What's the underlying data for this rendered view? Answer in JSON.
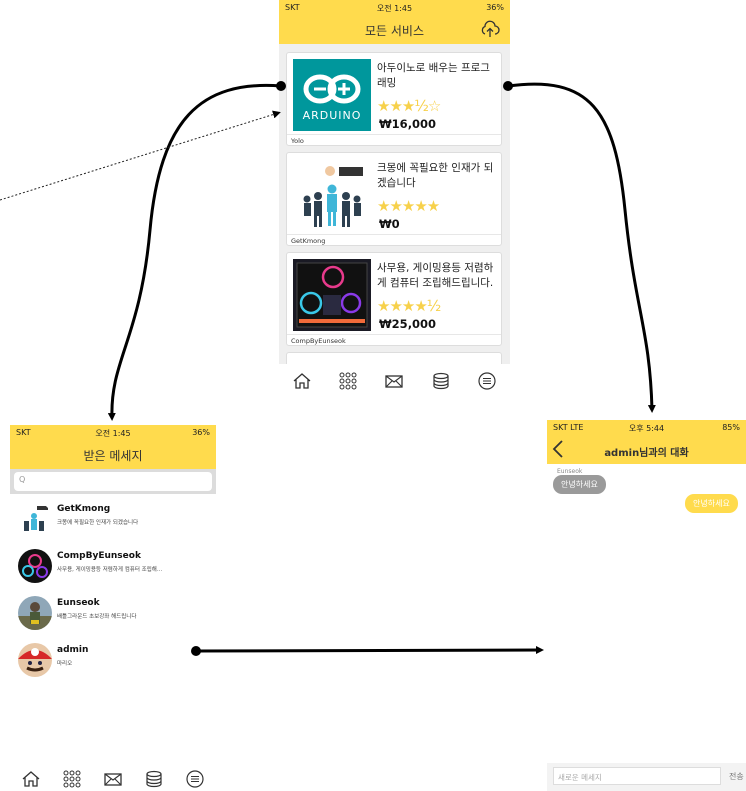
{
  "services_screen": {
    "status": {
      "carrier": "SKT",
      "time": "오전 1:45",
      "battery": "36%"
    },
    "title": "모든 서비스",
    "upload_icon": "cloud-upload-icon",
    "cards": [
      {
        "title": "아두이노로 배우는 프로그래밍",
        "stars": "★★★½☆",
        "rating": 3.5,
        "price": "₩16,000",
        "seller": "Yolo",
        "thumb_text": "ARDUINO"
      },
      {
        "title": "크몽에 꼭필요한 인재가 되겠습니다",
        "stars": "★★★★★",
        "rating": 5,
        "price": "₩0",
        "seller": "GetKmong"
      },
      {
        "title": "사무용, 게이밍용등 저렴하게 컴퓨터 조립해드립니다.",
        "stars": "★★★★½",
        "rating": 4.5,
        "price": "₩25,000",
        "seller": "CompByEunseok"
      }
    ],
    "tabs": [
      "home-icon",
      "grid-icon",
      "mail-icon",
      "database-icon",
      "menu-icon"
    ]
  },
  "messages_screen": {
    "status": {
      "carrier": "SKT",
      "time": "오전 1:45",
      "battery": "36%"
    },
    "title": "받은 메세지",
    "search_placeholder": "Q",
    "chats": [
      {
        "name": "GetKmong",
        "message": "크몽에 꼭필요한 인재가 되겠습니다"
      },
      {
        "name": "CompByEunseok",
        "message": "사무용, 게이밍용등 저렴하게 컴퓨터 조립해…"
      },
      {
        "name": "Eunseok",
        "message": "배틀그라운드 초보강좌 해드립니다"
      },
      {
        "name": "admin",
        "message": "마리오"
      }
    ],
    "tabs": [
      "home-icon",
      "grid-icon",
      "mail-icon",
      "database-icon",
      "menu-icon"
    ]
  },
  "chat_screen": {
    "status": {
      "carrier": "SKT LTE",
      "time": "오후 5:44",
      "battery": "85%"
    },
    "title": "admin님과의 대화",
    "sender_label": "Eunseok",
    "incoming": "안녕하세요",
    "outgoing": "안녕하세요",
    "input_placeholder": "새로운 메세지",
    "send_label": "전송"
  },
  "colors": {
    "brand_yellow": "#ffdb4d",
    "star": "#f7d14b",
    "arduino": "#00979c",
    "incoming_bubble": "#9a9a9a"
  }
}
